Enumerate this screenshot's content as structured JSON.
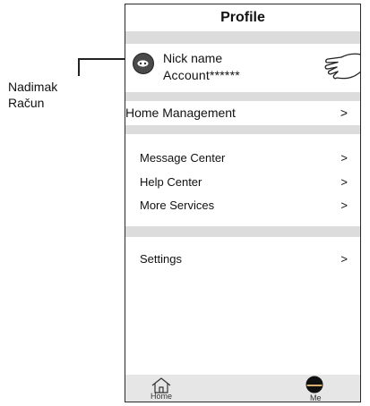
{
  "callout": {
    "line1": "Nadimak",
    "line2": "Račun"
  },
  "header": {
    "title": "Profile"
  },
  "profile": {
    "nickname": "Nick name",
    "account": "Account******"
  },
  "menu": {
    "home_management": "Home Management",
    "message_center": "Message Center",
    "help_center": "Help Center",
    "more_services": "More Services",
    "settings": "Settings",
    "chevron": ">"
  },
  "tabbar": {
    "home_label": "Home",
    "me_label": "Me"
  },
  "colors": {
    "band": "#dcdcdc",
    "tabbar": "#e6e6e6",
    "border": "#2a2a2a"
  },
  "icons": [
    "pointing-hand-icon",
    "avatar-icon",
    "home-icon",
    "me-icon"
  ]
}
